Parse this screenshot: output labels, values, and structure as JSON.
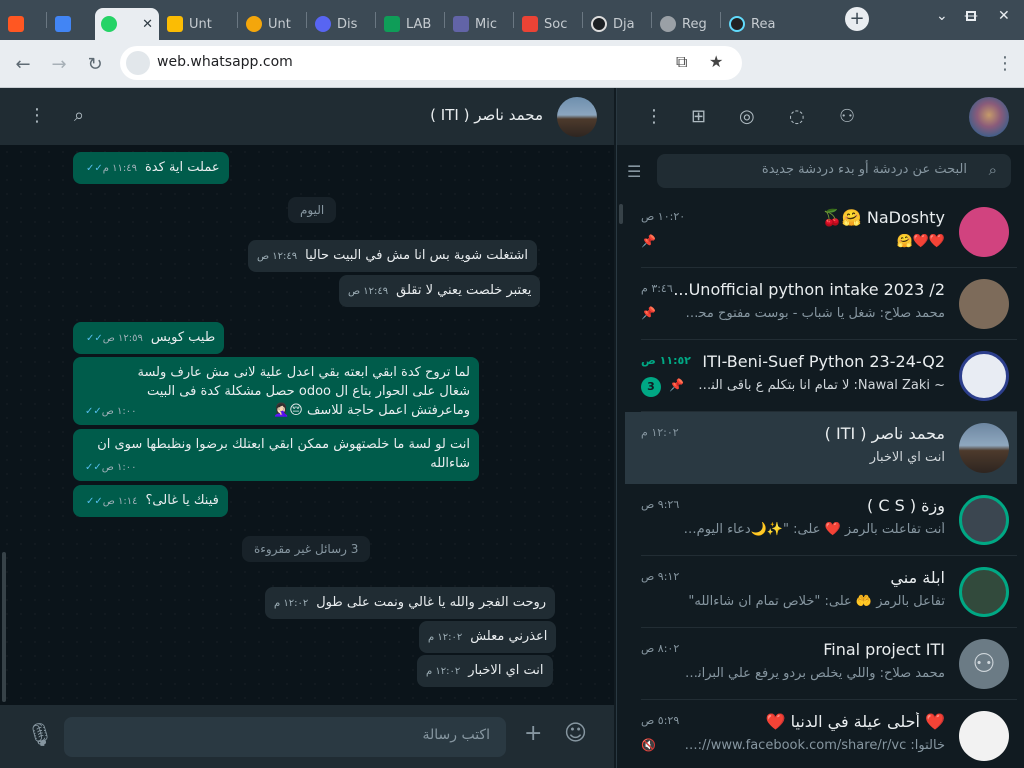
{
  "browser": {
    "tabs": [
      {
        "label": "",
        "color": "#ff5722"
      },
      {
        "label": "",
        "color": "#4285f4"
      },
      {
        "label": "",
        "color": "#25d366",
        "active": true
      },
      {
        "label": "Unt",
        "color": "#fbbc04"
      },
      {
        "label": "Unt",
        "color": "#f4a60b"
      },
      {
        "label": "Dis",
        "color": "#5865f2"
      },
      {
        "label": "LAB",
        "color": "#0f9d58"
      },
      {
        "label": "Mic",
        "color": "#6264a7"
      },
      {
        "label": "Soc",
        "color": "#ea4335"
      },
      {
        "label": "Dja",
        "color": "#1b1f23"
      },
      {
        "label": "Reg",
        "color": "#9aa0a6"
      },
      {
        "label": "Rea",
        "color": "#61dafb"
      }
    ],
    "url": "web.whatsapp.com"
  },
  "chat": {
    "contact_name": "محمد ناصر ( ITI )",
    "messages": [
      {
        "dir": "out",
        "text": "عملت اية كدة",
        "time": "١١:٤٩ م",
        "read": true
      },
      {
        "dir": "in",
        "text": "اشتغلت شوية بس انا مش في البيت حاليا",
        "time": "١٢:٤٩ ص"
      },
      {
        "dir": "in",
        "text": "يعتبر خلصت يعني لا تقلق",
        "time": "١٢:٤٩ ص"
      },
      {
        "dir": "out",
        "text": "طيب كويس",
        "time": "١٢:٥٩ ص",
        "read": true
      },
      {
        "dir": "out",
        "line1": "لما تروح كدة ابقي ابعته بقي اعدل علية لانى مش عارف ولسة",
        "line2": "شغال على الحوار بتاع ال odoo حصل مشكلة كدة فى البيت",
        "line3": "وماعرفتش اعمل حاجة للاسف 😔🤦🏻‍♀️",
        "time": "١:٠٠ ص",
        "read": true
      },
      {
        "dir": "out",
        "line1": "انت لو لسة ما خلصتهوش ممكن ابقي ابعتلك برضوا ونظبطها سوى ان",
        "line2": "شاءالله",
        "time": "١:٠٠ ص",
        "read": true
      },
      {
        "dir": "out",
        "text": "فينك يا غالى؟",
        "time": "١:١٤ ص",
        "read": true
      },
      {
        "dir": "in",
        "text": "روحت الفجر والله يا غالي ونمت على طول",
        "time": "١٢:٠٢ م"
      },
      {
        "dir": "in",
        "text": "اعذرني معلش",
        "time": "١٢:٠٢ م"
      },
      {
        "dir": "in",
        "text": "انت اي الاخبار",
        "time": "١٢:٠٢ م"
      }
    ],
    "date_divider": "اليوم",
    "unread_divider": "3 رسائل غير مقروءة",
    "composer_placeholder": "اكتب رسالة"
  },
  "sidebar": {
    "search_placeholder": "البحث عن دردشة أو بدء دردشة جديدة",
    "chats": [
      {
        "title": "NaDoshty 🤗🍒",
        "preview": "❤️❤️🤗",
        "time": "١٠:٢٠ ص",
        "pinned": true,
        "avatar": "#d1437f"
      },
      {
        "title": "Unofficial python intake 2023 /2...",
        "preview": "محمد صلاح: شغل يا شباب - بوست مفتوح  محتا...",
        "time": "٣:٤٦ م",
        "pinned": true,
        "avatar": "#7d6b5a"
      },
      {
        "title": "ITI-Beni-Suef Python 23-24-Q2",
        "preview": "~ Nawal Zaki: لا تمام انا بتكلم ع باقى الناس",
        "time": "١١:٥٢ ص",
        "pinned": true,
        "unread": "3",
        "avatar": "#e8ecf3"
      },
      {
        "title": "محمد ناصر ( ITI )",
        "preview": "انت اي الاخبار",
        "time": "١٢:٠٢ م",
        "selected": true,
        "avatar": "#6d86a1"
      },
      {
        "title": "وزة ( C S )",
        "preview": "أنت تفاعلت بالرمز ❤️ على: \"✨🌙دعاء اليوم الثال...",
        "time": "٩:٢٦ ص",
        "avatar": "#3b4650"
      },
      {
        "title": "ابلة مني",
        "preview": "تفاعل بالرمز 🤲 على: \"خلاص تمام ان شاءالله\"",
        "time": "٩:١٢ ص",
        "avatar": "#324a3c"
      },
      {
        "title": "Final project ITI",
        "preview": "محمد صلاح: واللي يخلص بردو يرفع علي البرانش ب...",
        "time": "٨:٠٢ ص",
        "avatar": "#6b7b85"
      },
      {
        "title": "❤️ أحلى عيلة في الدنيا ❤️",
        "preview": "خالتوا: https://www.facebook.com/share/r/vc...",
        "time": "٥:٢٩ ص",
        "muted": true,
        "avatar": "#f2f2f2"
      }
    ]
  }
}
